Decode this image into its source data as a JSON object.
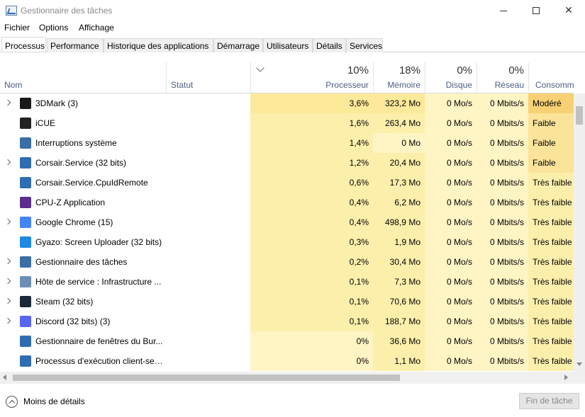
{
  "window": {
    "title": "Gestionnaire des tâches"
  },
  "menu": [
    "Fichier",
    "Options",
    "Affichage"
  ],
  "tabs": [
    "Processus",
    "Performance",
    "Historique des applications",
    "Démarrage",
    "Utilisateurs",
    "Détails",
    "Services"
  ],
  "active_tab": 0,
  "columns": {
    "name": "Nom",
    "status": "Statut",
    "cpu": {
      "pct": "10%",
      "label": "Processeur"
    },
    "memory": {
      "pct": "18%",
      "label": "Mémoire"
    },
    "disk": {
      "pct": "0%",
      "label": "Disque"
    },
    "network": {
      "pct": "0%",
      "label": "Réseau"
    },
    "power": {
      "label": "Consommatio"
    }
  },
  "processes": [
    {
      "name": "3DMark (3)",
      "expandable": true,
      "icon": "3dmark-icon",
      "icon_color": "#1a1a1a",
      "cpu": "3,6%",
      "mem": "323,2 Mo",
      "disk": "0 Mo/s",
      "net": "0 Mbits/s",
      "power": "Modéré",
      "cpu_bg": "#fde99a",
      "mem_bg": "#fde99a",
      "power_bg": "#f7d173"
    },
    {
      "name": "iCUE",
      "expandable": false,
      "icon": "icue-icon",
      "icon_color": "#222222",
      "cpu": "1,6%",
      "mem": "263,4 Mo",
      "disk": "0 Mo/s",
      "net": "0 Mbits/s",
      "power": "Faible",
      "cpu_bg": "#fcefac",
      "mem_bg": "#fcefac",
      "power_bg": "#fbe49a"
    },
    {
      "name": "Interruptions système",
      "expandable": false,
      "icon": "system-icon",
      "icon_color": "#3a6ea5",
      "cpu": "1,4%",
      "mem": "0 Mo",
      "disk": "0 Mo/s",
      "net": "0 Mbits/s",
      "power": "Faible",
      "cpu_bg": "#fcefac",
      "mem_bg": "#fff4c4",
      "power_bg": "#fbe49a"
    },
    {
      "name": "Corsair.Service (32 bits)",
      "expandable": true,
      "icon": "window-icon",
      "icon_color": "#2f6db3",
      "cpu": "1,2%",
      "mem": "20,4 Mo",
      "disk": "0 Mo/s",
      "net": "0 Mbits/s",
      "power": "Faible",
      "cpu_bg": "#fcefac",
      "mem_bg": "#fcefac",
      "power_bg": "#fbe49a"
    },
    {
      "name": "Corsair.Service.CpuIdRemote",
      "expandable": false,
      "icon": "window-icon",
      "icon_color": "#2f6db3",
      "cpu": "0,6%",
      "mem": "17,3 Mo",
      "disk": "0 Mo/s",
      "net": "0 Mbits/s",
      "power": "Très faible",
      "cpu_bg": "#fcefac",
      "mem_bg": "#fcefac",
      "power_bg": "#fcefac"
    },
    {
      "name": "CPU-Z Application",
      "expandable": false,
      "icon": "cpuz-icon",
      "icon_color": "#5b2d8c",
      "cpu": "0,4%",
      "mem": "6,2 Mo",
      "disk": "0 Mo/s",
      "net": "0 Mbits/s",
      "power": "Très faible",
      "cpu_bg": "#fcefac",
      "mem_bg": "#fcefac",
      "power_bg": "#fcefac"
    },
    {
      "name": "Google Chrome (15)",
      "expandable": true,
      "icon": "chrome-icon",
      "icon_color": "#4285f4",
      "cpu": "0,4%",
      "mem": "498,9 Mo",
      "disk": "0 Mo/s",
      "net": "0 Mbits/s",
      "power": "Très faible",
      "cpu_bg": "#fcefac",
      "mem_bg": "#fcefac",
      "power_bg": "#fcefac"
    },
    {
      "name": "Gyazo: Screen Uploader (32 bits)",
      "expandable": false,
      "icon": "gyazo-icon",
      "icon_color": "#1e88e5",
      "cpu": "0,3%",
      "mem": "1,9 Mo",
      "disk": "0 Mo/s",
      "net": "0 Mbits/s",
      "power": "Très faible",
      "cpu_bg": "#fcefac",
      "mem_bg": "#fcefac",
      "power_bg": "#fcefac"
    },
    {
      "name": "Gestionnaire des tâches",
      "expandable": true,
      "icon": "taskmgr-icon",
      "icon_color": "#3a6ea5",
      "cpu": "0,2%",
      "mem": "30,4 Mo",
      "disk": "0 Mo/s",
      "net": "0 Mbits/s",
      "power": "Très faible",
      "cpu_bg": "#fcefac",
      "mem_bg": "#fcefac",
      "power_bg": "#fcefac"
    },
    {
      "name": "Hôte de service : Infrastructure ...",
      "expandable": true,
      "icon": "gear-icon",
      "icon_color": "#6d8fb5",
      "cpu": "0,1%",
      "mem": "7,3 Mo",
      "disk": "0 Mo/s",
      "net": "0 Mbits/s",
      "power": "Très faible",
      "cpu_bg": "#fcefac",
      "mem_bg": "#fcefac",
      "power_bg": "#fcefac"
    },
    {
      "name": "Steam (32 bits)",
      "expandable": true,
      "icon": "steam-icon",
      "icon_color": "#1b2838",
      "cpu": "0,1%",
      "mem": "70,6 Mo",
      "disk": "0 Mo/s",
      "net": "0 Mbits/s",
      "power": "Très faible",
      "cpu_bg": "#fcefac",
      "mem_bg": "#fcefac",
      "power_bg": "#fcefac"
    },
    {
      "name": "Discord (32 bits) (3)",
      "expandable": true,
      "icon": "discord-icon",
      "icon_color": "#5865f2",
      "cpu": "0,1%",
      "mem": "188,7 Mo",
      "disk": "0 Mo/s",
      "net": "0 Mbits/s",
      "power": "Très faible",
      "cpu_bg": "#fcefac",
      "mem_bg": "#fcefac",
      "power_bg": "#fcefac"
    },
    {
      "name": "Gestionnaire de fenêtres du Bur...",
      "expandable": false,
      "icon": "window-icon",
      "icon_color": "#2f6db3",
      "cpu": "0%",
      "mem": "36,6 Mo",
      "disk": "0 Mo/s",
      "net": "0 Mbits/s",
      "power": "Très faible",
      "cpu_bg": "#fff4c4",
      "mem_bg": "#fcefac",
      "power_bg": "#fcefac"
    },
    {
      "name": "Processus d'exécution client-ser...",
      "expandable": false,
      "icon": "window-icon",
      "icon_color": "#2f6db3",
      "cpu": "0%",
      "mem": "1,1 Mo",
      "disk": "0 Mo/s",
      "net": "0 Mbits/s",
      "power": "Très faible",
      "cpu_bg": "#fff4c4",
      "mem_bg": "#fcefac",
      "power_bg": "#fcefac"
    }
  ],
  "default_cell_bg": "#fff4c4",
  "footer": {
    "less_details": "Moins de détails",
    "end_task": "Fin de tâche"
  }
}
